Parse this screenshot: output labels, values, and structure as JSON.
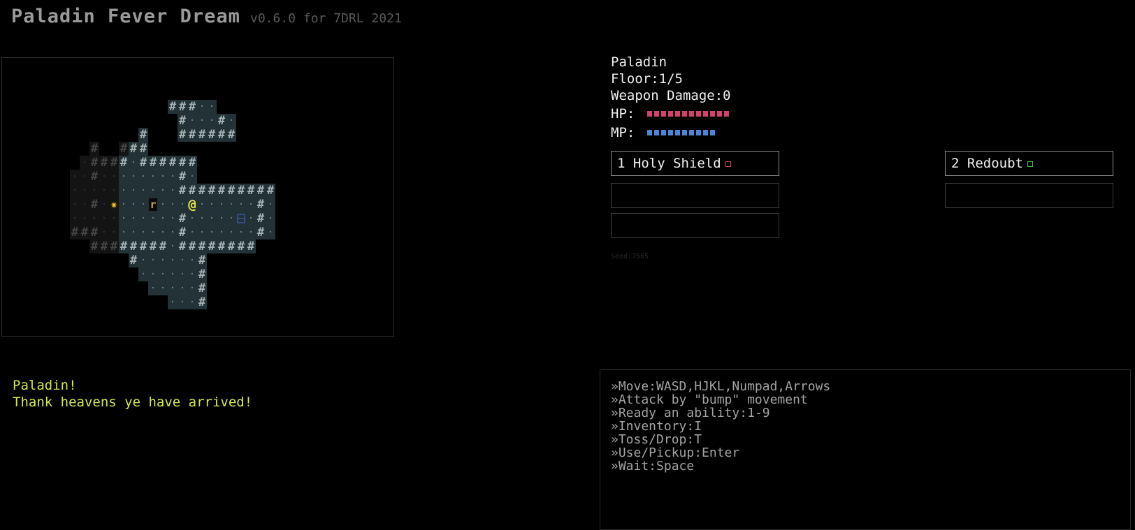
{
  "header": {
    "title": "Paladin Fever Dream",
    "version": "v0.6.0 for 7DRL 2021"
  },
  "stats": {
    "class_name": "Paladin",
    "floor": "Floor:1/5",
    "weapon_damage": "Weapon Damage:0",
    "hp_label": "HP:",
    "mp_label": "MP:",
    "hp_pips": 12,
    "mp_pips": 10,
    "hp_color": "#d6406e",
    "mp_color": "#4a86d8"
  },
  "abilities": [
    {
      "label": "1 Holy Shield",
      "indicator_color": "#d84848"
    },
    {
      "label": "2 Redoubt",
      "indicator_color": "#3cc84a"
    },
    {
      "label": "",
      "indicator_color": ""
    },
    {
      "label": "",
      "indicator_color": ""
    },
    {
      "label": "",
      "indicator_color": ""
    }
  ],
  "seed": "Seed:7565",
  "messages": [
    "Paladin!",
    "Thank heavens ye have arrived!"
  ],
  "help": [
    "»Move:WASD,HJKL,Numpad,Arrows",
    "»Attack by \"bump\" movement",
    "»Ready an ability:1-9",
    "»Inventory:I",
    "»Toss/Drop:T",
    "»Use/Pickup:Enter",
    "»Wait:Space"
  ],
  "map": {
    "glyphs": {
      "player": "@",
      "rat": "r",
      "burst": "✷",
      "wall": "#",
      "floor": "·"
    },
    "colors": {
      "lit_bg": "#223236",
      "mem_bg": "#141414",
      "wall_lit": "#a6b2b4",
      "wall_mem": "#464646",
      "floor_lit": "#6e8a8c",
      "floor_mem": "#353535",
      "player": "#e4e84a",
      "rat": "#c8a048",
      "burst": "#f0c020",
      "item": "#4466d0"
    }
  }
}
